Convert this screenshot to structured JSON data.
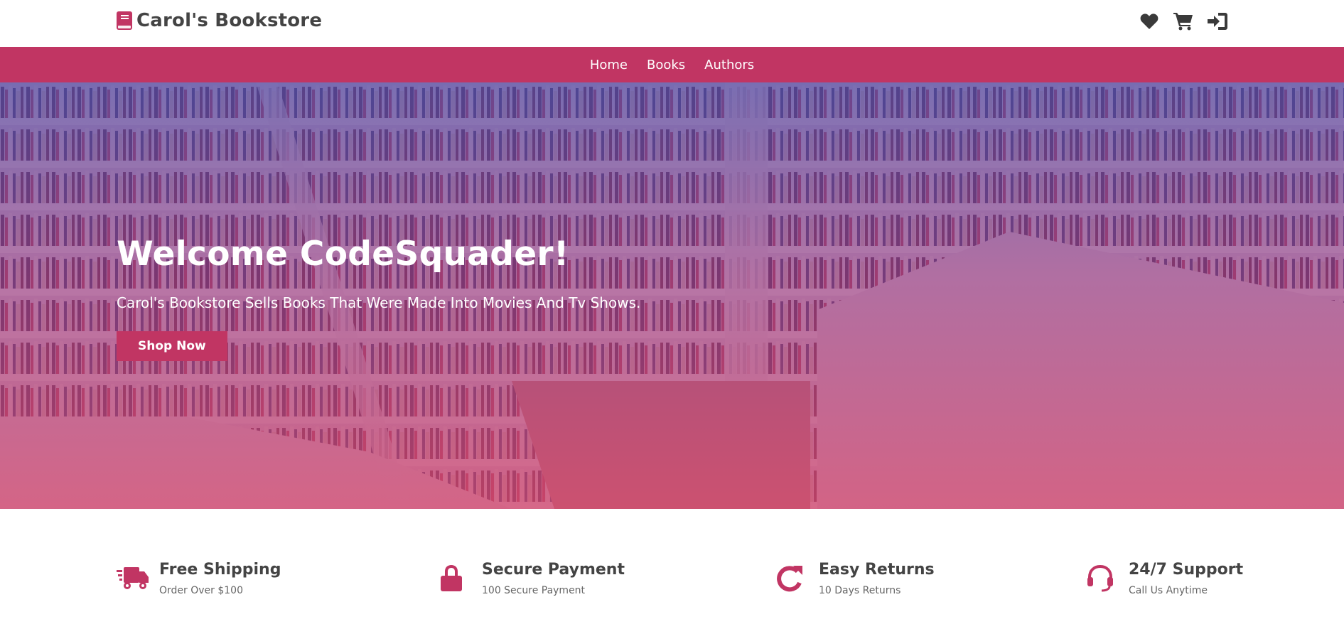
{
  "header": {
    "brand_name": "Carol's Bookstore",
    "icons": [
      "heart-icon",
      "cart-icon",
      "sign-in-icon"
    ]
  },
  "nav": {
    "items": [
      {
        "label": "Home"
      },
      {
        "label": "Books"
      },
      {
        "label": "Authors"
      }
    ]
  },
  "hero": {
    "title": "Welcome CodeSquader!",
    "subtitle": "Carol's Bookstore Sells Books That Were Made Into Movies And Tv Shows.",
    "button_label": "Shop Now"
  },
  "features": [
    {
      "icon": "truck-icon",
      "title": "Free Shipping",
      "subtitle": "Order Over $100"
    },
    {
      "icon": "lock-icon",
      "title": "Secure Payment",
      "subtitle": "100 Secure Payment"
    },
    {
      "icon": "redo-icon",
      "title": "Easy Returns",
      "subtitle": "10 Days Returns"
    },
    {
      "icon": "headset-icon",
      "title": "24/7 Support",
      "subtitle": "Call Us Anytime"
    }
  ],
  "colors": {
    "accent": "#c13563",
    "text_dark": "#444444",
    "text_muted": "#666666"
  }
}
